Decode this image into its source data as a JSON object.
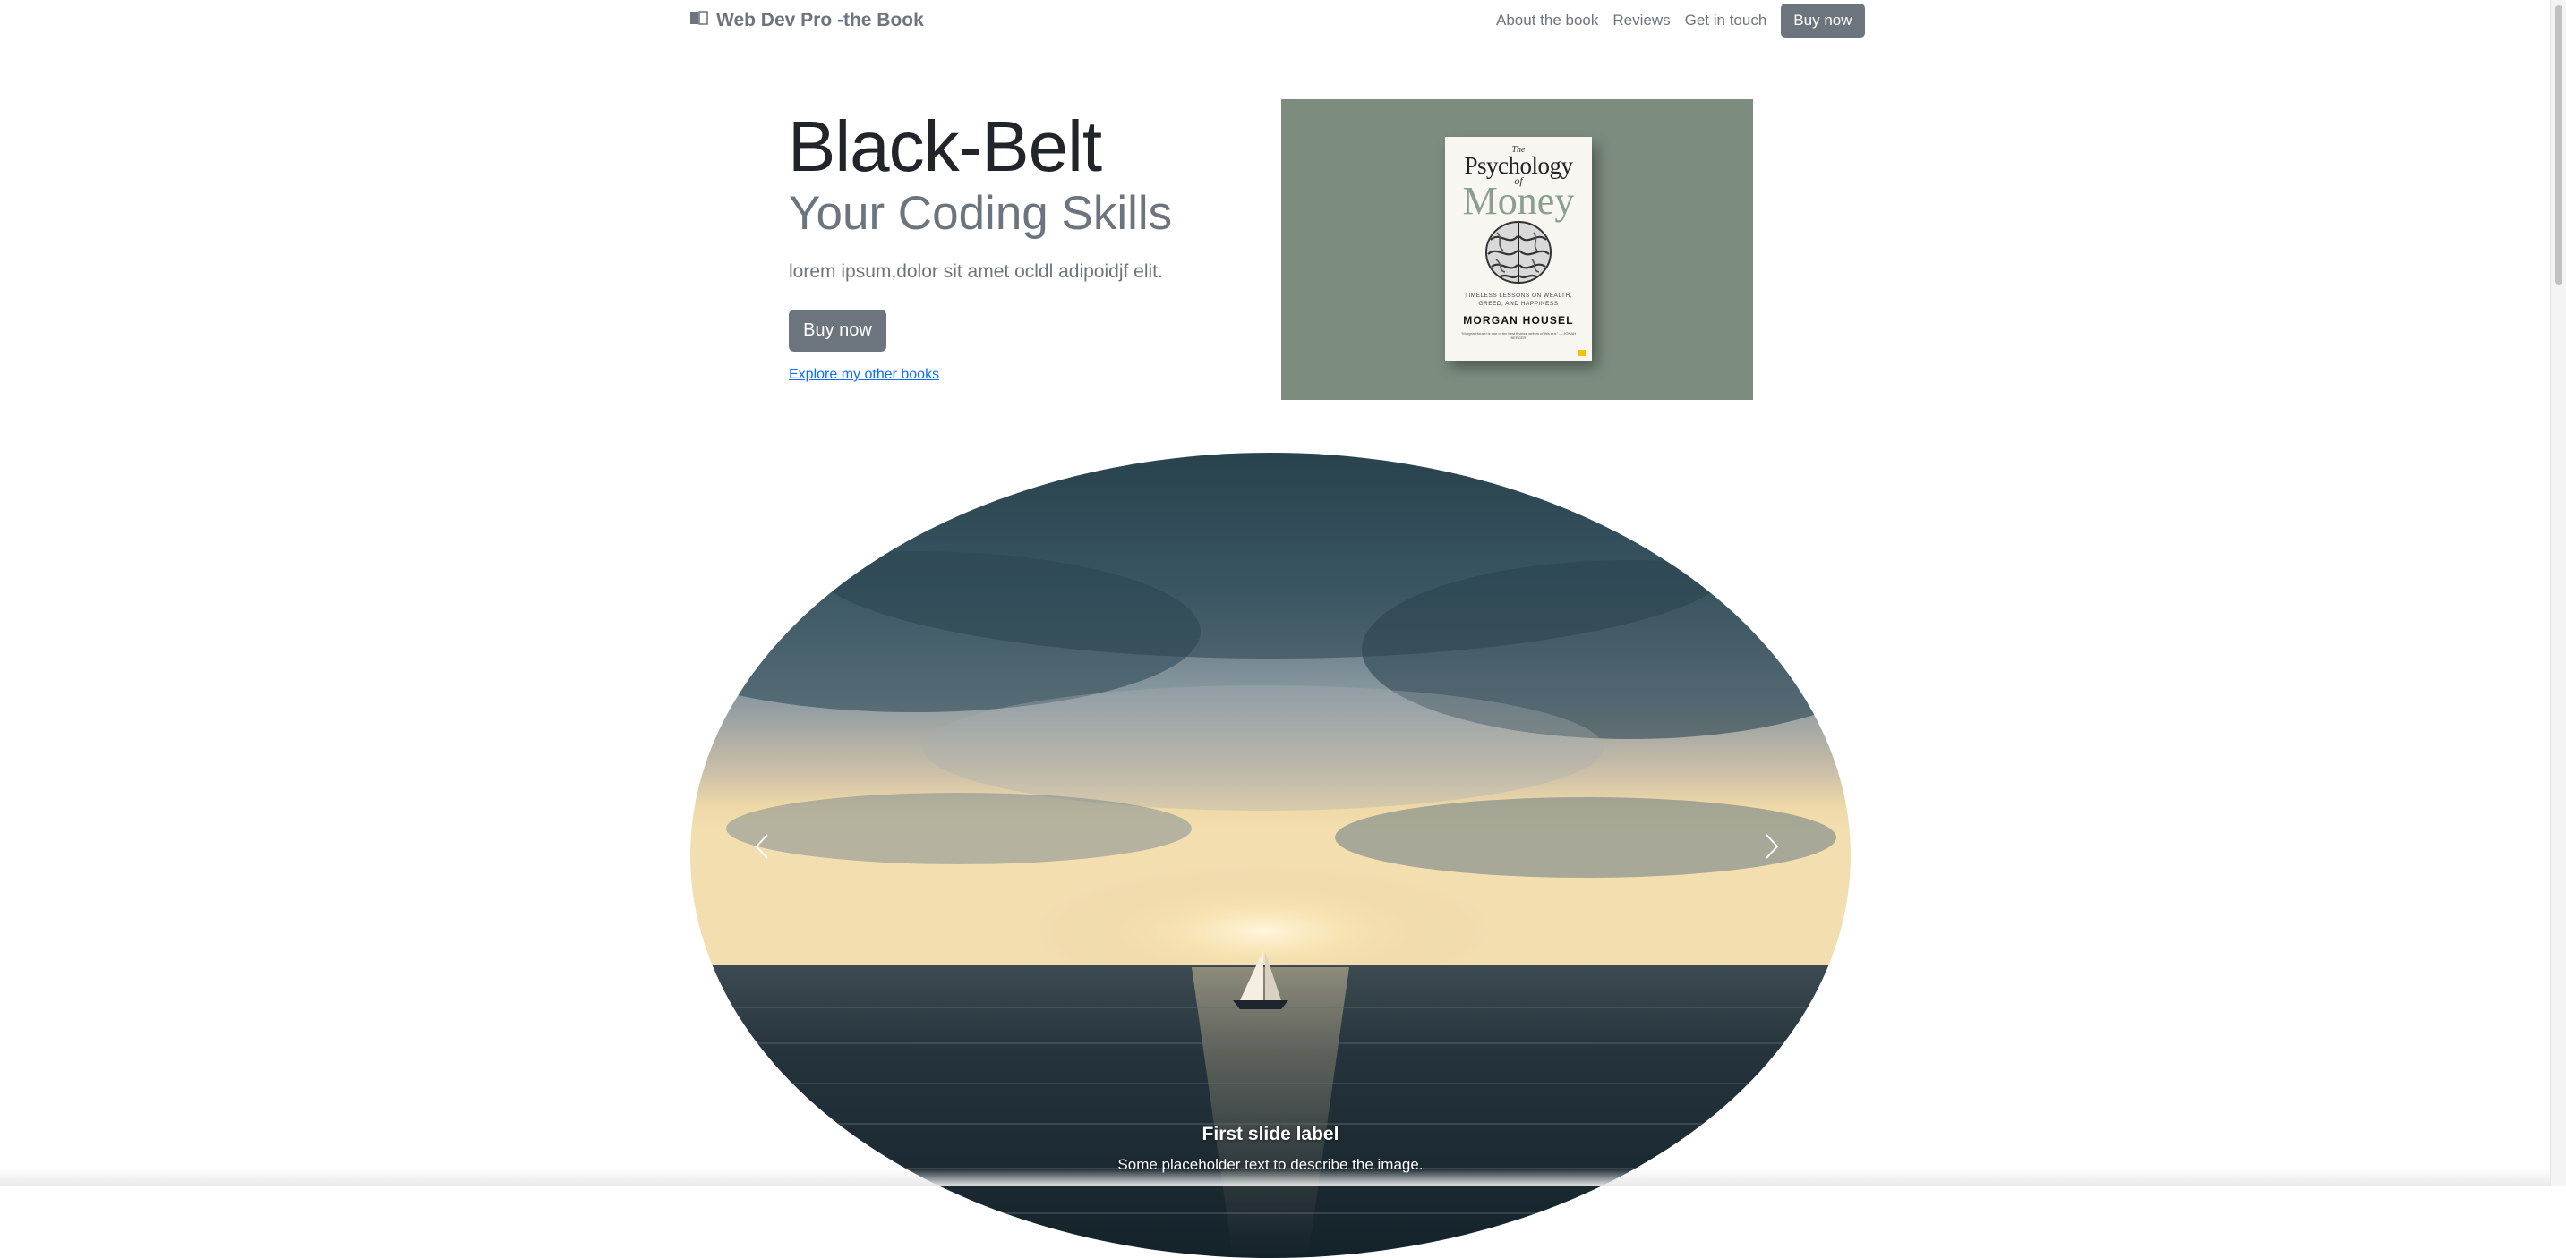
{
  "navbar": {
    "brand": "Web Dev Pro -the Book",
    "brand_icon": "book-icon",
    "links": [
      "About the book",
      "Reviews",
      "Get in touch"
    ],
    "cta_label": "Buy now"
  },
  "hero": {
    "title": "Black-Belt",
    "subtitle": "Your Coding Skills",
    "lead": "lorem ipsum,dolor sit amet ocldl adipoidjf elit.",
    "button_label": "Buy now",
    "link_text": "Explore my other books"
  },
  "book": {
    "the": "The",
    "title_1": "Psychology",
    "of": "of",
    "title_2": "Money",
    "tagline": "TIMELESS LESSONS ON WEALTH, GREED, AND HAPPINESS",
    "author": "MORGAN HOUSEL",
    "quote": "\"Morgan Housel is one of the best finance writers of this era.\" — JONAH BERGER"
  },
  "carousel": {
    "caption_title": "First slide label",
    "caption_text": "Some placeholder text to describe the image.",
    "prev_icon": "chevron-left-icon",
    "next_icon": "chevron-right-icon"
  },
  "colors": {
    "secondary": "#6c757d",
    "link": "#0d6efd",
    "book_panel": "#7c8c7f",
    "money_green": "#8a9f8e"
  }
}
